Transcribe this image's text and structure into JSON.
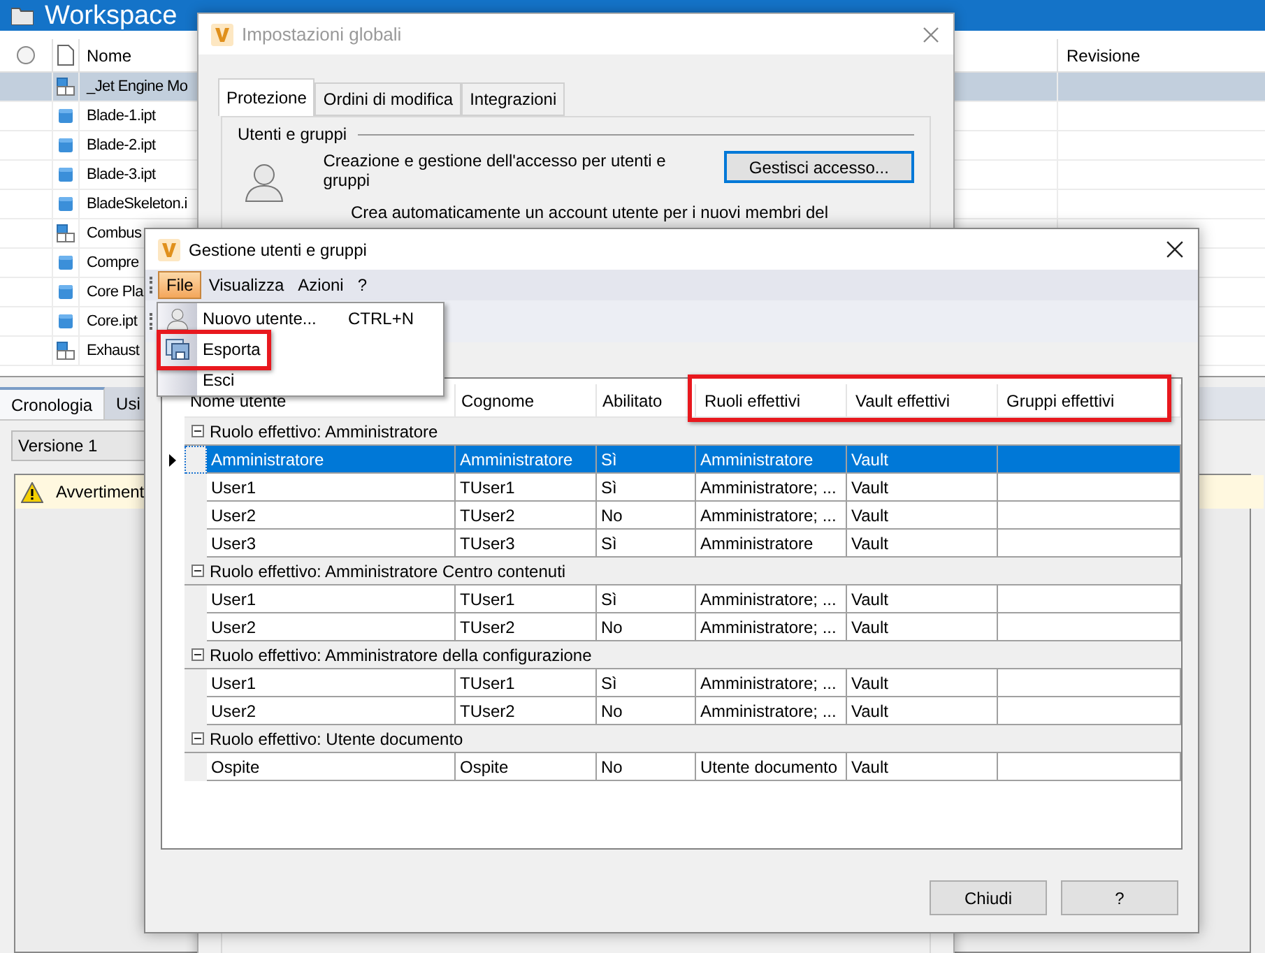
{
  "workspace": {
    "title": "Workspace",
    "columns": [
      "Nome",
      "Revisione"
    ],
    "files": [
      {
        "name": "_Jet Engine Mo",
        "kind": "assembly",
        "selected": true
      },
      {
        "name": "Blade-1.ipt",
        "kind": "part",
        "selected": false
      },
      {
        "name": "Blade-2.ipt",
        "kind": "part",
        "selected": false
      },
      {
        "name": "Blade-3.ipt",
        "kind": "part",
        "selected": false
      },
      {
        "name": "BladeSkeleton.i",
        "kind": "part",
        "selected": false
      },
      {
        "name": "Combus",
        "kind": "assembly",
        "selected": false
      },
      {
        "name": "Compre",
        "kind": "part",
        "selected": false
      },
      {
        "name": "Core Pla",
        "kind": "part",
        "selected": false
      },
      {
        "name": "Core.ipt",
        "kind": "part",
        "selected": false
      },
      {
        "name": "Exhaust",
        "kind": "assembly",
        "selected": false
      }
    ]
  },
  "bottom_panel": {
    "tabs": [
      {
        "label": "Cronologia",
        "selected": true
      },
      {
        "label": "Usi",
        "selected": false
      }
    ],
    "version": "Versione 1",
    "warning": "Avvertiment"
  },
  "settings_dialog": {
    "title": "Impostazioni globali",
    "tabs": [
      {
        "label": "Protezione",
        "selected": true
      },
      {
        "label": "Ordini di modifica",
        "selected": false
      },
      {
        "label": "Integrazioni",
        "selected": false
      }
    ],
    "section": "Utenti e gruppi",
    "description": "Creazione e gestione dell'accesso per utenti e gruppi",
    "button": "Gestisci accesso...",
    "option": "Crea automaticamente un account utente per i nuovi membri del"
  },
  "users_dialog": {
    "title": "Gestione utenti e gruppi",
    "menu": [
      {
        "label": "File",
        "selected": true
      },
      {
        "label": "Visualizza",
        "selected": false
      },
      {
        "label": "Azioni",
        "selected": false
      },
      {
        "label": "?",
        "selected": false
      }
    ],
    "file_menu": [
      {
        "label": "Nuovo utente...",
        "shortcut": "CTRL+N",
        "kind": "user",
        "highlighted": false
      },
      {
        "label": "Esporta",
        "kind": "export",
        "highlighted": true
      },
      {
        "label": "Esci",
        "kind": "plain",
        "highlighted": false
      }
    ],
    "table": {
      "columns": [
        {
          "label": "Nome utente",
          "highlighted": false
        },
        {
          "label": "Cognome",
          "highlighted": false
        },
        {
          "label": "Abilitato",
          "highlighted": false
        },
        {
          "label": "Ruoli effettivi",
          "highlighted": true
        },
        {
          "label": "Vault effettivi",
          "highlighted": true
        },
        {
          "label": "Gruppi effettivi",
          "highlighted": true
        }
      ],
      "groups": [
        {
          "title": "Ruolo effettivo: Amministratore",
          "expanded": true,
          "rows": [
            {
              "cells": [
                "Amministratore",
                "Amministratore",
                "Sì",
                "Amministratore",
                "Vault"
              ],
              "selected": true
            },
            {
              "cells": [
                "User1",
                "TUser1",
                "Sì",
                "Amministratore; ...",
                "Vault"
              ],
              "selected": false
            },
            {
              "cells": [
                "User2",
                "TUser2",
                "No",
                "Amministratore; ...",
                "Vault"
              ],
              "selected": false
            },
            {
              "cells": [
                "User3",
                "TUser3",
                "Sì",
                "Amministratore",
                "Vault"
              ],
              "selected": false
            }
          ]
        },
        {
          "title": "Ruolo effettivo: Amministratore Centro contenuti",
          "expanded": true,
          "rows": [
            {
              "cells": [
                "User1",
                "TUser1",
                "Sì",
                "Amministratore; ...",
                "Vault"
              ],
              "selected": false
            },
            {
              "cells": [
                "User2",
                "TUser2",
                "No",
                "Amministratore; ...",
                "Vault"
              ],
              "selected": false
            }
          ]
        },
        {
          "title": "Ruolo effettivo: Amministratore della configurazione",
          "expanded": true,
          "rows": [
            {
              "cells": [
                "User1",
                "TUser1",
                "Sì",
                "Amministratore; ...",
                "Vault"
              ],
              "selected": false
            },
            {
              "cells": [
                "User2",
                "TUser2",
                "No",
                "Amministratore; ...",
                "Vault"
              ],
              "selected": false
            }
          ]
        },
        {
          "title": "Ruolo effettivo: Utente documento",
          "expanded": true,
          "rows": [
            {
              "cells": [
                "Ospite",
                "Ospite",
                "No",
                "Utente documento",
                "Vault"
              ],
              "selected": false
            }
          ]
        }
      ]
    },
    "buttons": [
      "Chiudi",
      "?"
    ]
  }
}
